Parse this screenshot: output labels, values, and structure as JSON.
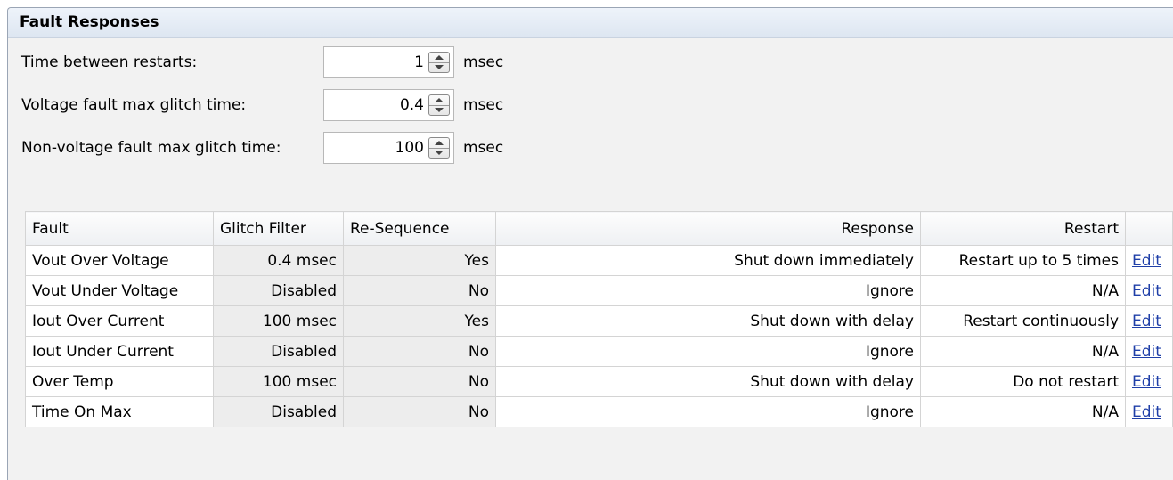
{
  "panel": {
    "title": "Fault Responses"
  },
  "settings": [
    {
      "label": "Time between restarts:",
      "value": "1",
      "unit": "msec"
    },
    {
      "label": "Voltage fault max glitch time:",
      "value": "0.4",
      "unit": "msec"
    },
    {
      "label": "Non-voltage fault max glitch time:",
      "value": "100",
      "unit": "msec"
    }
  ],
  "table": {
    "headers": [
      "Fault",
      "Glitch Filter",
      "Re-Sequence",
      "Response",
      "Restart",
      ""
    ],
    "rows": [
      {
        "fault": "Vout Over Voltage",
        "glitch": "0.4 msec",
        "reseq": "Yes",
        "response": "Shut down immediately",
        "restart": "Restart up to 5 times",
        "edit": "Edit"
      },
      {
        "fault": "Vout Under Voltage",
        "glitch": "Disabled",
        "reseq": "No",
        "response": "Ignore",
        "restart": "N/A",
        "edit": "Edit"
      },
      {
        "fault": "Iout Over Current",
        "glitch": "100 msec",
        "reseq": "Yes",
        "response": "Shut down with delay",
        "restart": "Restart continuously",
        "edit": "Edit"
      },
      {
        "fault": "Iout Under Current",
        "glitch": "Disabled",
        "reseq": "No",
        "response": "Ignore",
        "restart": "N/A",
        "edit": "Edit"
      },
      {
        "fault": "Over Temp",
        "glitch": "100 msec",
        "reseq": "No",
        "response": "Shut down with delay",
        "restart": "Do not restart",
        "edit": "Edit"
      },
      {
        "fault": "Time On Max",
        "glitch": "Disabled",
        "reseq": "No",
        "response": "Ignore",
        "restart": "N/A",
        "edit": "Edit"
      }
    ]
  },
  "colors": {
    "link": "#1f3fa8",
    "header_bg": "#dde6f1",
    "panel_bg": "#f2f2f2"
  }
}
